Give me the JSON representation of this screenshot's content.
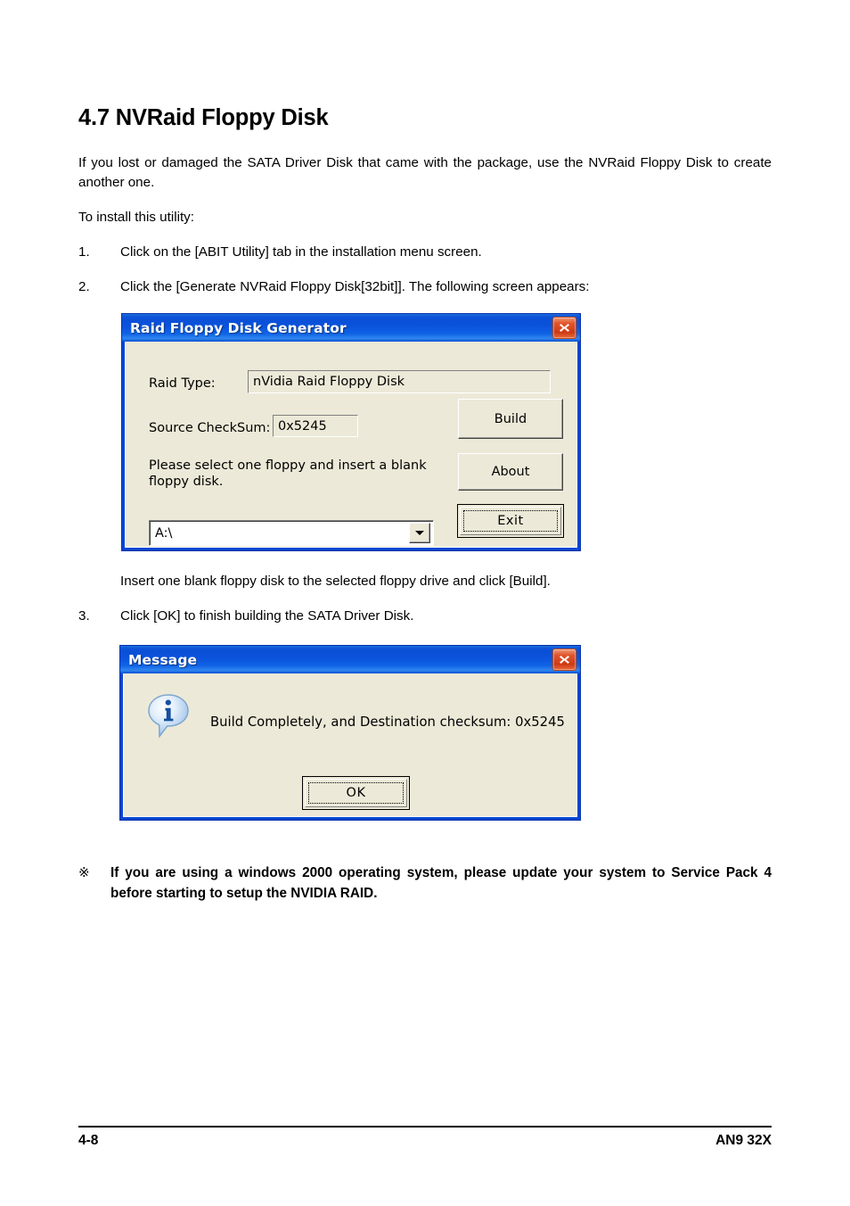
{
  "document": {
    "section_title": "4.7 NVRaid Floppy Disk",
    "intro": "If you lost or damaged the SATA Driver Disk that came with the package, use the NVRaid Floppy Disk to create another one.",
    "install_lead": "To install this utility:",
    "steps": [
      {
        "num": "1.",
        "text": "Click on the [ABIT Utility] tab in the installation menu screen."
      },
      {
        "num": "2.",
        "text": "Click the [Generate NVRaid Floppy Disk[32bit]]. The following screen appears:"
      },
      {
        "num": "3.",
        "text": "Click [OK] to finish building the SATA Driver Disk."
      }
    ],
    "insert_note": "Insert one blank floppy disk to the selected floppy drive and click [Build].",
    "warning": {
      "mark": "※",
      "text": "If you are using a windows 2000 operating system, please update your system to Service Pack 4 before starting to setup the NVIDIA RAID."
    }
  },
  "footer": {
    "page_number": "4-8",
    "model": "AN9 32X"
  },
  "generator_dialog": {
    "title": "Raid Floppy Disk Generator",
    "close_label": "Close",
    "raid_type_label": "Raid Type:",
    "raid_type_value": "nVidia Raid Floppy Disk",
    "checksum_label": "Source CheckSum:",
    "checksum_value": "0x5245",
    "instruction": "Please select one floppy and insert a blank\nfloppy disk.",
    "drive_value": "A:\\",
    "drive_options": [
      "A:\\"
    ],
    "build_label": "Build",
    "about_label": "About",
    "exit_label": "Exit"
  },
  "message_dialog": {
    "title": "Message",
    "close_label": "Close",
    "icon": "info-icon",
    "message": "Build Completely, and Destination checksum: 0x5245",
    "ok_label": "OK"
  },
  "colors": {
    "titlebar_blue": "#0a4fd6",
    "dialog_face": "#ece9d8",
    "close_red": "#cf3a13",
    "page_background": "#ffffff"
  }
}
